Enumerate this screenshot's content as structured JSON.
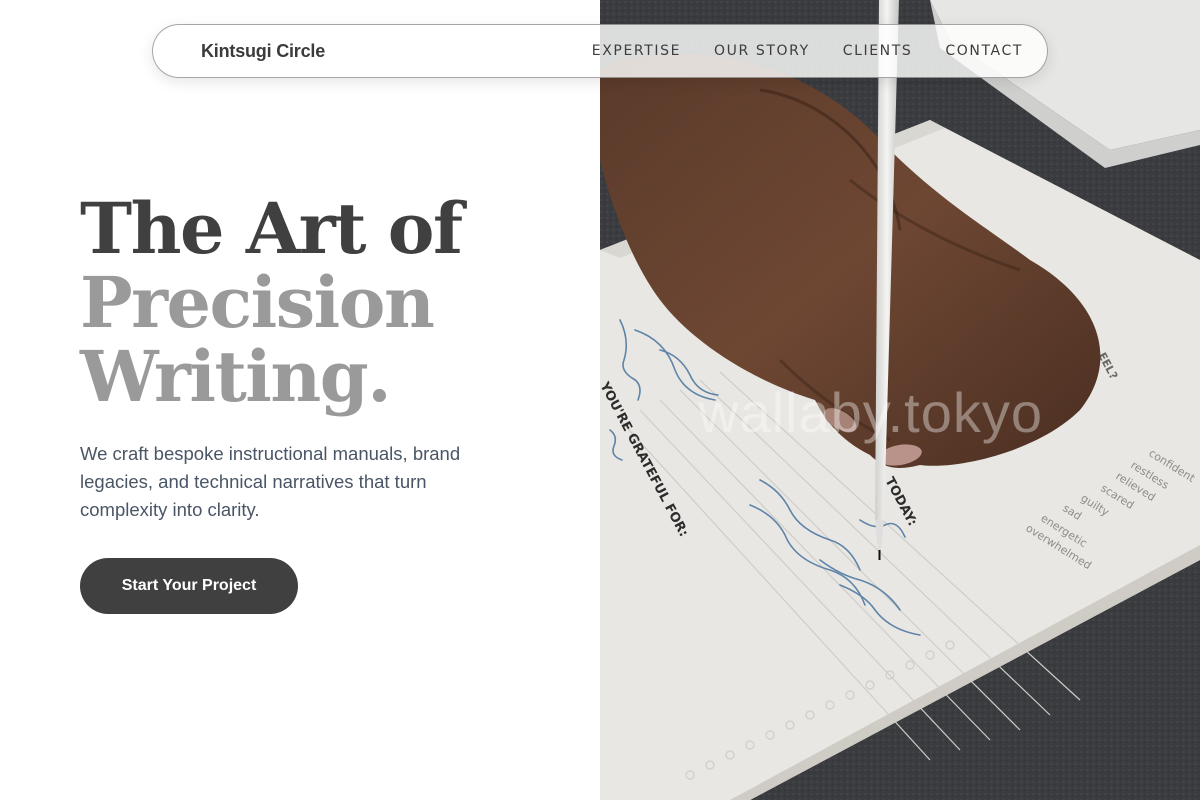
{
  "nav": {
    "brand": "Kintsugi Circle",
    "links": [
      "EXPERTISE",
      "OUR STORY",
      "CLIENTS",
      "CONTACT"
    ]
  },
  "hero": {
    "headline_line1": "The Art of",
    "headline_line2": "Precision",
    "headline_line3": "Writing.",
    "description": "We craft bespoke instructional manuals, brand legacies, and technical narratives that turn complexity into clarity.",
    "cta_label": "Start Your Project"
  },
  "image": {
    "subject": "hand-writing-in-journal-photo",
    "watermark": "wallaby.tokyo"
  },
  "colors": {
    "heading_dark": "#404040",
    "heading_light": "#9a9a9a",
    "body_text": "#4a5566",
    "button_bg": "#404040",
    "button_text": "#ffffff"
  }
}
